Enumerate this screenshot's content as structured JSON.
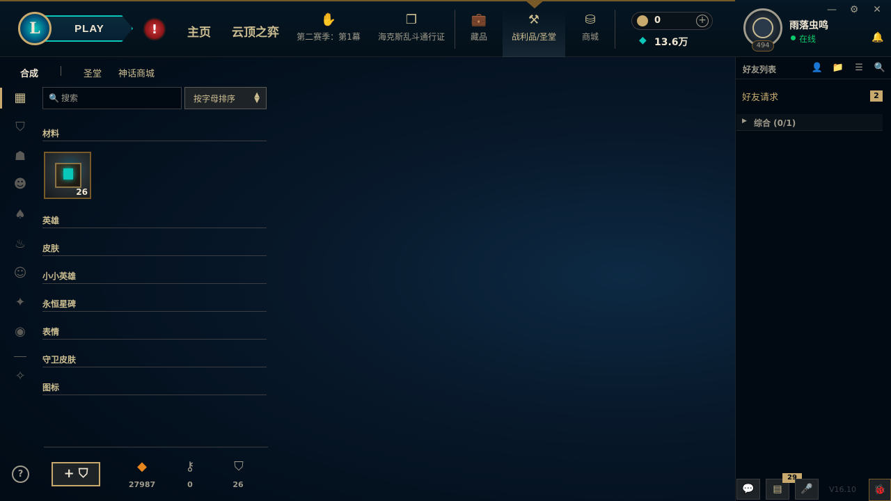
{
  "top": {
    "play_label": "PLAY",
    "nav_home": "主页",
    "nav_tft": "云顶之弈",
    "nav_items": [
      {
        "label": "第二赛季：第1幕",
        "icon": "season-pass-icon"
      },
      {
        "label": "海克斯乱斗通行证",
        "icon": "event-pass-icon"
      },
      {
        "label": "藏品",
        "icon": "collection-icon"
      },
      {
        "label": "战利品/圣堂",
        "icon": "loot-icon"
      },
      {
        "label": "商城",
        "icon": "store-icon"
      }
    ],
    "rp_value": "0",
    "be_value": "13.6万"
  },
  "profile": {
    "name": "雨落虫鸣",
    "status": "在线",
    "level": "494"
  },
  "subtabs": [
    "合成",
    "圣堂",
    "神话商城"
  ],
  "search": {
    "placeholder": "搜索"
  },
  "sort": {
    "label": "按字母排序"
  },
  "categories": [
    "材料",
    "英雄",
    "皮肤",
    "小小英雄",
    "永恒星碑",
    "表情",
    "守卫皮肤",
    "图标"
  ],
  "material_item": {
    "count": "26"
  },
  "resources": {
    "orange_essence": "27987",
    "keys": "0",
    "chests": "26"
  },
  "social": {
    "title": "好友列表",
    "friend_requests_label": "好友请求",
    "friend_requests_count": "2",
    "group_label": "综合 (0/1)",
    "notifications_count": "29",
    "version": "V16.10"
  },
  "colors": {
    "gold": "#c8aa6e",
    "teal": "#0ac8b9",
    "online": "#0acb6b",
    "alert": "#d13639"
  }
}
